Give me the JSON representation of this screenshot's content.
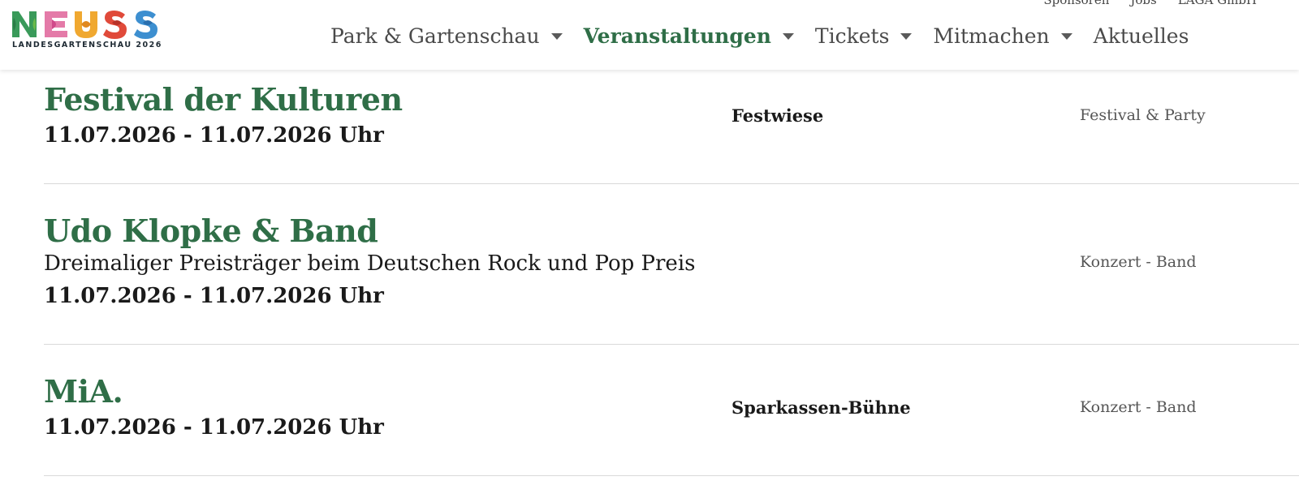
{
  "brand": {
    "logo_text": "NEUSS",
    "subtitle": "LANDESGARTENSCHAU 2026",
    "colors": {
      "n": "#3a9a5a",
      "e": "#e47aa8",
      "u": "#f0a830",
      "s1": "#e04a3a",
      "s2": "#3d8fd0"
    }
  },
  "topbar": {
    "links": [
      "Sponsoren",
      "Jobs",
      "LAGA GmbH"
    ]
  },
  "nav": {
    "items": [
      {
        "label": "Park & Gartenschau",
        "dropdown": true
      },
      {
        "label": "Veranstaltungen",
        "dropdown": true,
        "active": true
      },
      {
        "label": "Tickets",
        "dropdown": true
      },
      {
        "label": "Mitmachen",
        "dropdown": true
      },
      {
        "label": "Aktuelles",
        "dropdown": false
      }
    ]
  },
  "events": [
    {
      "title": "Festival der Kulturen",
      "subtitle": "",
      "date": "11.07.2026 - 11.07.2026 Uhr",
      "location": "Festwiese",
      "category": "Festival & Party"
    },
    {
      "title": "Udo Klopke & Band",
      "subtitle": "Dreimaliger Preisträger beim Deutschen Rock und Pop Preis",
      "date": "11.07.2026 - 11.07.2026 Uhr",
      "location": "",
      "category": "Konzert - Band"
    },
    {
      "title": "MiA.",
      "subtitle": "",
      "date": "11.07.2026 - 11.07.2026 Uhr",
      "location": "Sparkassen-Bühne",
      "category": "Konzert - Band"
    }
  ],
  "theme": {
    "accent": "#2f6e47",
    "divider": "#d9d9d9"
  }
}
